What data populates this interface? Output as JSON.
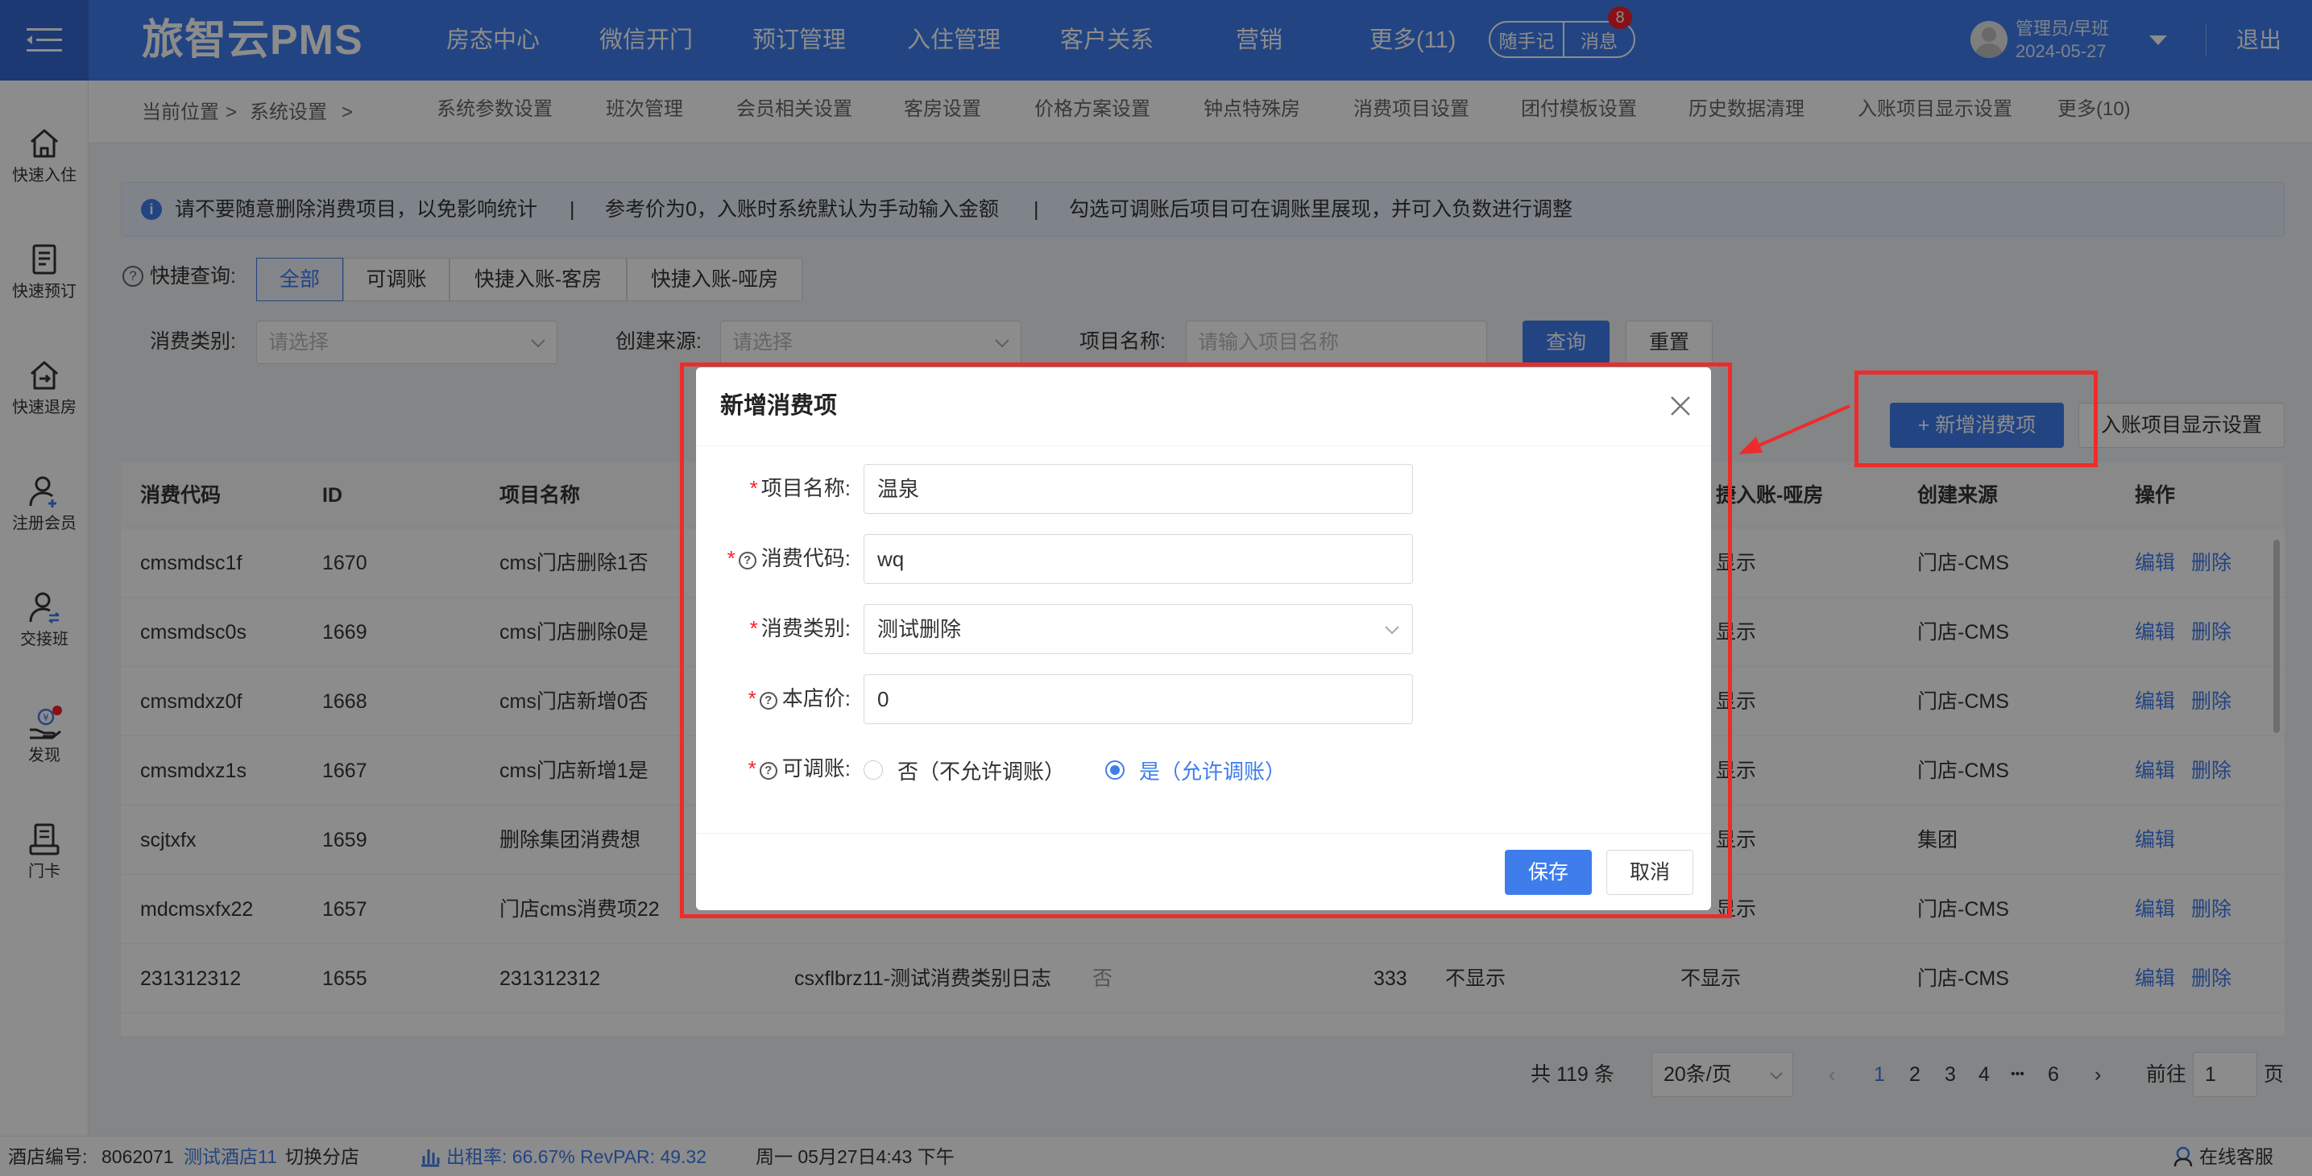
{
  "header": {
    "logo": "旅智云PMS",
    "nav": [
      "房态中心",
      "微信开门",
      "预订管理",
      "入住管理",
      "客户关系",
      "营销",
      "更多(11)"
    ],
    "notes_button": "随手记",
    "messages_button": "消息",
    "messages_badge": "8",
    "user_name": "管理员/早班",
    "user_date": "2024-05-27",
    "logout": "退出"
  },
  "sidebar": {
    "items": [
      {
        "label": "快速入住",
        "icon": "home-icon"
      },
      {
        "label": "快速预订",
        "icon": "booking-icon"
      },
      {
        "label": "快速退房",
        "icon": "checkout-icon"
      },
      {
        "label": "注册会员",
        "icon": "add-member-icon"
      },
      {
        "label": "交接班",
        "icon": "shift-handover-icon"
      },
      {
        "label": "发现",
        "icon": "discover-icon"
      },
      {
        "label": "门卡",
        "icon": "door-card-icon"
      }
    ]
  },
  "breadcrumb": {
    "current_label": "当前位置",
    "sep1": ">",
    "section": "系统设置",
    "sep2": ">"
  },
  "subnav": [
    "系统参数设置",
    "班次管理",
    "会员相关设置",
    "客房设置",
    "价格方案设置",
    "钟点特殊房",
    "消费项目设置",
    "团付模板设置",
    "历史数据清理",
    "入账项目显示设置",
    "更多(10)"
  ],
  "notice": {
    "text1": "请不要随意删除消费项目，以免影响统计",
    "sep": "|",
    "text2": "参考价为0，入账时系统默认为手动输入金额",
    "text3": "勾选可调账后项目可在调账里展现，并可入负数进行调整"
  },
  "quick_query": {
    "label": "快捷查询:",
    "tabs": [
      "全部",
      "可调账",
      "快捷入账-客房",
      "快捷入账-哑房"
    ]
  },
  "filters": {
    "category_label": "消费类别:",
    "category_placeholder": "请选择",
    "source_label": "创建来源:",
    "source_placeholder": "请选择",
    "name_label": "项目名称:",
    "name_placeholder": "请输入项目名称",
    "query_button": "查询",
    "reset_button": "重置"
  },
  "actions": {
    "add_button": "+ 新增消费项",
    "display_settings_button": "入账项目显示设置"
  },
  "table": {
    "headers": [
      "消费代码",
      "ID",
      "项目名称",
      "捷入账-哑房",
      "创建来源",
      "操作"
    ],
    "rows": [
      {
        "code": "cmsmdsc1f",
        "id": "1670",
        "name": "cms门店删除1否",
        "dummy": "显示",
        "source": "门店-CMS",
        "edit": "编辑",
        "del": "删除"
      },
      {
        "code": "cmsmdsc0s",
        "id": "1669",
        "name": "cms门店删除0是",
        "dummy": "显示",
        "source": "门店-CMS",
        "edit": "编辑",
        "del": "删除"
      },
      {
        "code": "cmsmdxz0f",
        "id": "1668",
        "name": "cms门店新增0否",
        "dummy": "显示",
        "source": "门店-CMS",
        "edit": "编辑",
        "del": "删除"
      },
      {
        "code": "cmsmdxz1s",
        "id": "1667",
        "name": "cms门店新增1是",
        "dummy": "显示",
        "source": "门店-CMS",
        "edit": "编辑",
        "del": "删除"
      },
      {
        "code": "scjtxfx",
        "id": "1659",
        "name": "删除集团消费想",
        "dummy": "显示",
        "source": "集团",
        "edit": "编辑",
        "del": ""
      },
      {
        "code": "mdcmsxfx22",
        "id": "1657",
        "name": "门店cms消费项22",
        "dummy": "显示",
        "source": "门店-CMS",
        "edit": "编辑",
        "del": "删除"
      },
      {
        "code": "231312312",
        "id": "1655",
        "name": "231312312",
        "category": "csxflbrz11-测试消费类别日志",
        "adjustable": "否",
        "price": "333",
        "room": "不显示",
        "dummy": "不显示",
        "source": "门店-CMS",
        "edit": "编辑",
        "del": "删除"
      }
    ]
  },
  "pagination": {
    "total": "共 119 条",
    "page_size": "20条/页",
    "pages": [
      "1",
      "2",
      "3",
      "4",
      "•••",
      "6"
    ],
    "goto_label": "前往",
    "goto_value": "1",
    "page_unit": "页"
  },
  "modal": {
    "title": "新增消费项",
    "fields": {
      "name_label": "项目名称:",
      "name_value": "温泉",
      "code_label": "消费代码:",
      "code_value": "wq",
      "category_label": "消费类别:",
      "category_value": "测试删除",
      "price_label": "本店价:",
      "price_value": "0",
      "adjust_label": "可调账:",
      "adjust_no": "否（不允许调账）",
      "adjust_yes": "是（允许调账）"
    },
    "save_button": "保存",
    "cancel_button": "取消"
  },
  "footer": {
    "hotel_no_label": "酒店编号:",
    "hotel_no": "8062071",
    "hotel_name": "测试酒店11",
    "switch_branch": "切换分店",
    "occupancy": "出租率: 66.67%  RevPAR: 49.32",
    "datetime": "周一 05月27日4:43 下午",
    "support": "在线客服"
  },
  "colors": {
    "primary": "#3f7ded",
    "danger": "#f5222d",
    "annotation_red": "#ee2b2b"
  }
}
